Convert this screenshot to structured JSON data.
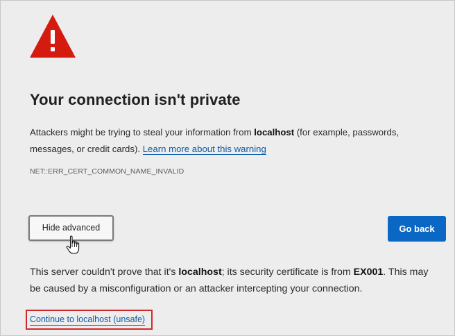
{
  "page": {
    "title": "Your connection isn't private",
    "intro_part1": "Attackers might be trying to steal your information from ",
    "intro_host": "localhost",
    "intro_part2": " (for example, passwords, messages, or credit cards). ",
    "learn_more_link": "Learn more about this warning",
    "error_code": "NET::ERR_CERT_COMMON_NAME_INVALID"
  },
  "buttons": {
    "hide_advanced": "Hide advanced",
    "go_back": "Go back"
  },
  "advanced": {
    "part1": "This server couldn't prove that it's ",
    "host": "localhost",
    "part2": "; its security certificate is from ",
    "issuer": "EX001",
    "part3": ". This may be caused by a misconfiguration or an attacker intercepting your connection.",
    "proceed_link": "Continue to localhost (unsafe)"
  },
  "colors": {
    "background": "#ededed",
    "warning_red": "#d51b10",
    "primary_blue": "#0a68c4",
    "link_blue": "#0b5aa8",
    "highlight_red": "#d22a2a"
  },
  "icons": {
    "warning": "warning-triangle-icon",
    "cursor": "hand-pointer-cursor-icon"
  }
}
